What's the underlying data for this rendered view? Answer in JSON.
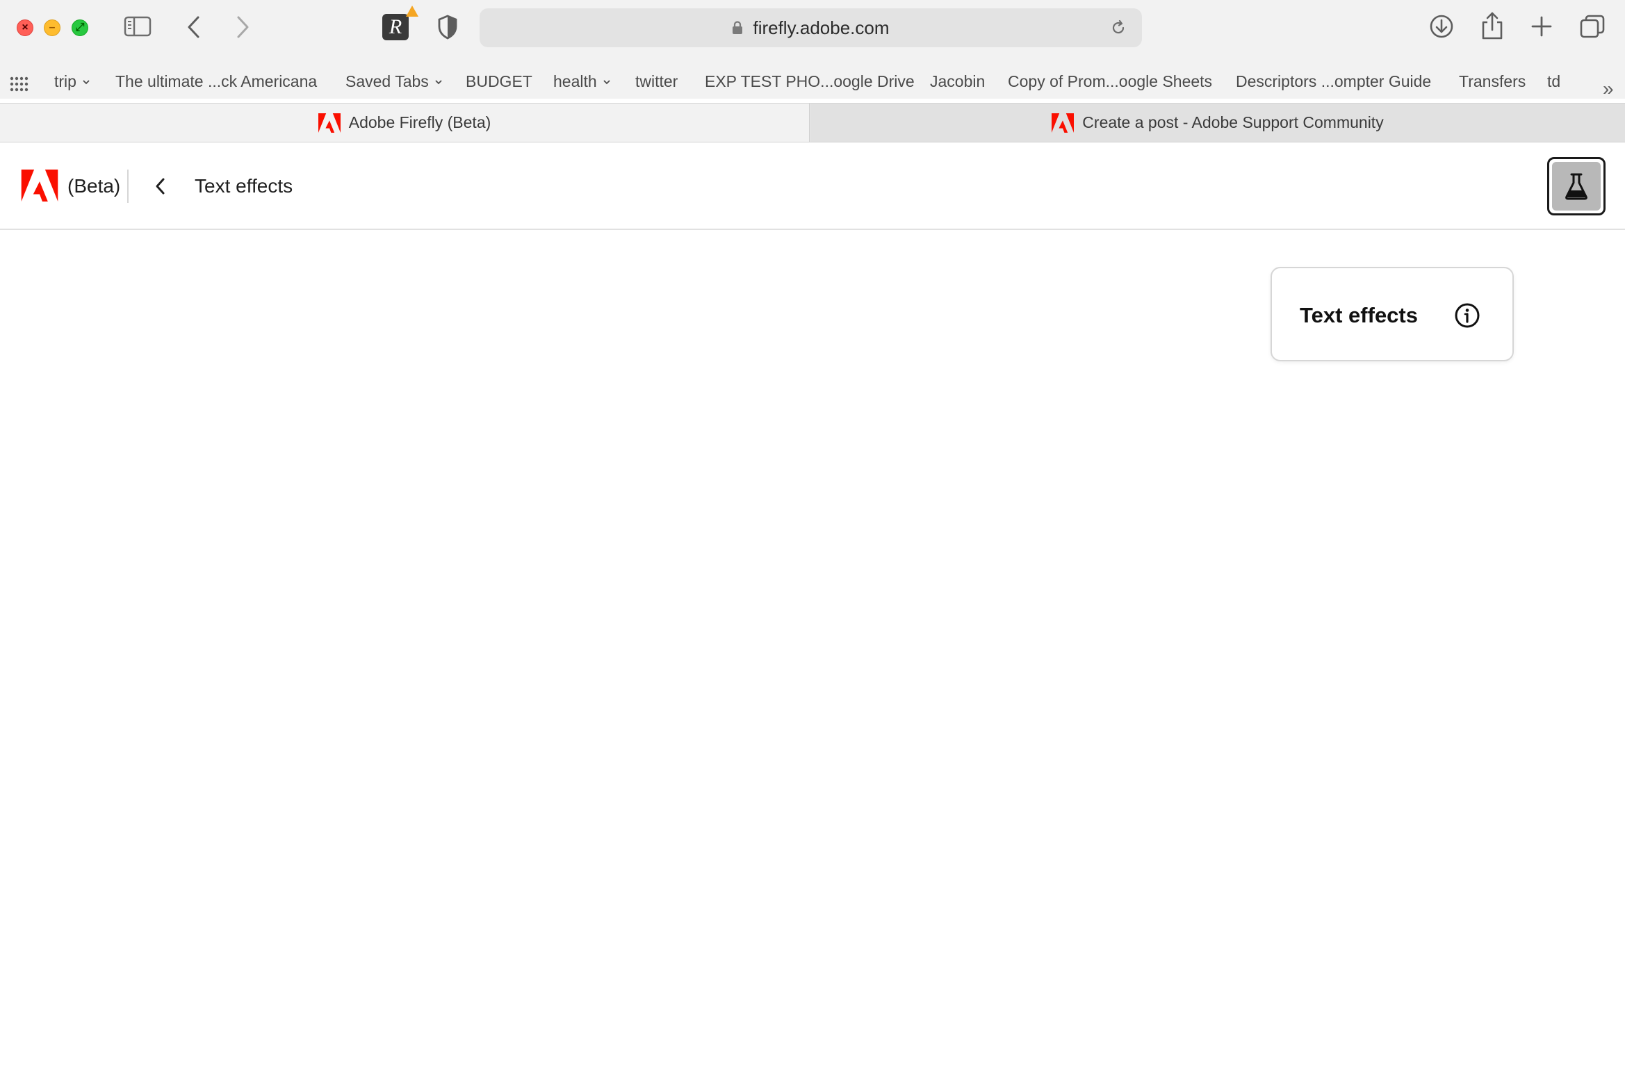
{
  "browser": {
    "url": "firefly.adobe.com",
    "bookmarks": [
      {
        "label": "trip",
        "has_menu": true
      },
      {
        "label": "The ultimate ...ck Americana",
        "has_menu": false
      },
      {
        "label": "Saved Tabs",
        "has_menu": true
      },
      {
        "label": "BUDGET",
        "has_menu": false
      },
      {
        "label": "health",
        "has_menu": true
      },
      {
        "label": "twitter",
        "has_menu": false
      },
      {
        "label": "EXP TEST PHO...oogle Drive",
        "has_menu": false
      },
      {
        "label": "Jacobin",
        "has_menu": false
      },
      {
        "label": "Copy of Prom...oogle Sheets",
        "has_menu": false
      },
      {
        "label": "Descriptors ...ompter Guide",
        "has_menu": false
      },
      {
        "label": "Transfers",
        "has_menu": false
      },
      {
        "label": "td",
        "has_menu": false
      }
    ],
    "bookmarks_overflow": "»",
    "tabs": [
      {
        "title": "Adobe Firefly (Beta)",
        "active": true
      },
      {
        "title": "Create a post - Adobe Support Community",
        "active": false
      }
    ],
    "extension_letter": "R"
  },
  "app": {
    "beta_label": "(Beta)",
    "page_title": "Text effects",
    "brand_color": "#fa0f00"
  },
  "popover": {
    "title": "Text effects"
  },
  "icons": {
    "close": "×",
    "minimize": "–",
    "maximize": "⤢"
  }
}
